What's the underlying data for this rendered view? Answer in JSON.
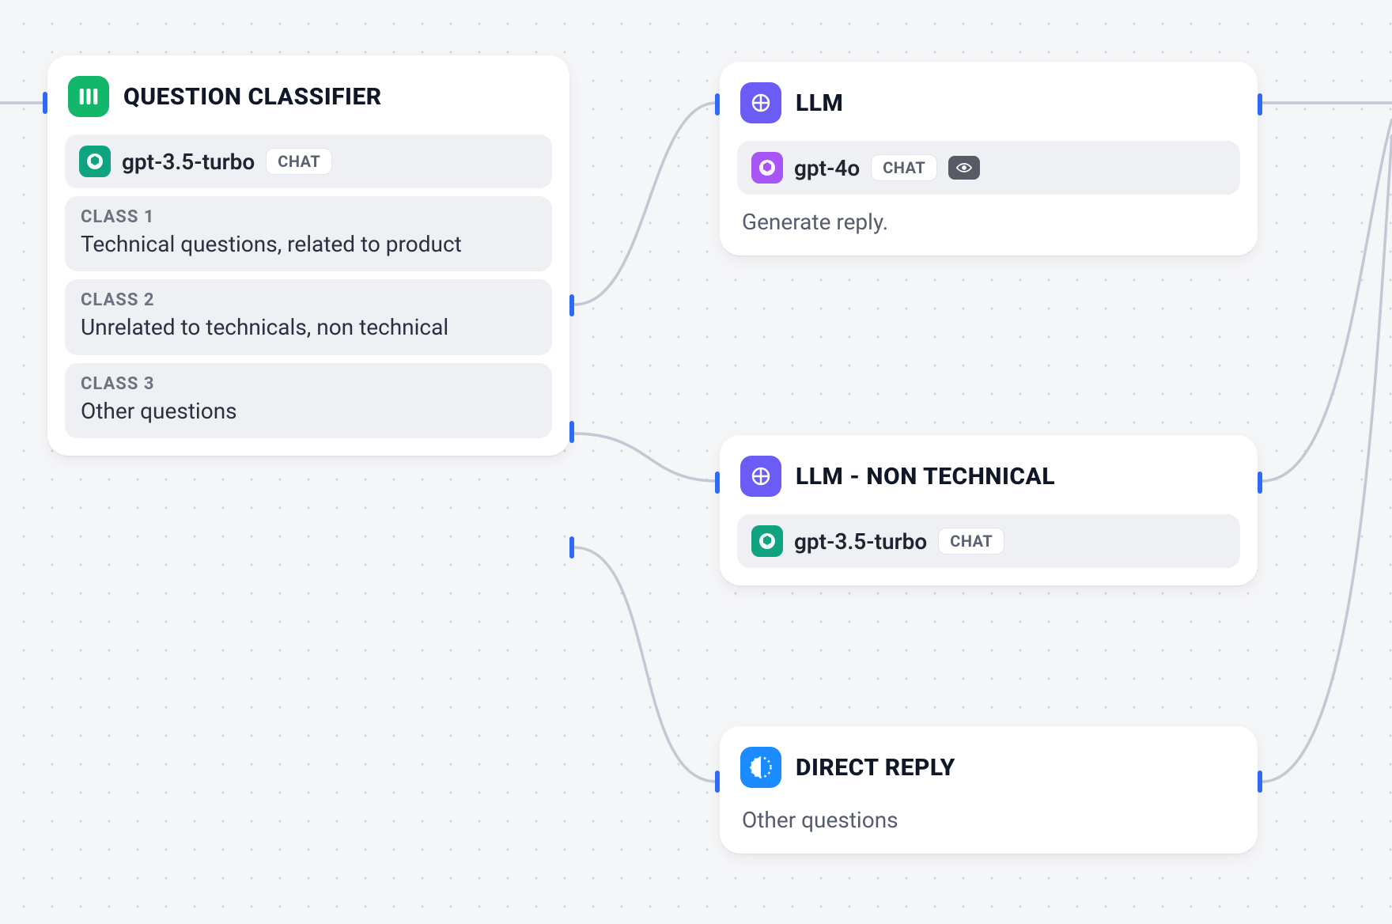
{
  "classifier": {
    "title": "QUESTION CLASSIFIER",
    "model": "gpt-3.5-turbo",
    "model_badge": "CHAT",
    "classes": [
      {
        "label": "CLASS 1",
        "text": "Technical questions, related to product"
      },
      {
        "label": "CLASS 2",
        "text": "Unrelated to technicals, non technical"
      },
      {
        "label": "CLASS 3",
        "text": "Other questions"
      }
    ]
  },
  "llm1": {
    "title": "LLM",
    "model": "gpt-4o",
    "model_badge": "CHAT",
    "description": "Generate reply."
  },
  "llm2": {
    "title": "LLM - NON TECHNICAL",
    "model": "gpt-3.5-turbo",
    "model_badge": "CHAT"
  },
  "direct": {
    "title": "DIRECT REPLY",
    "description": "Other questions"
  }
}
